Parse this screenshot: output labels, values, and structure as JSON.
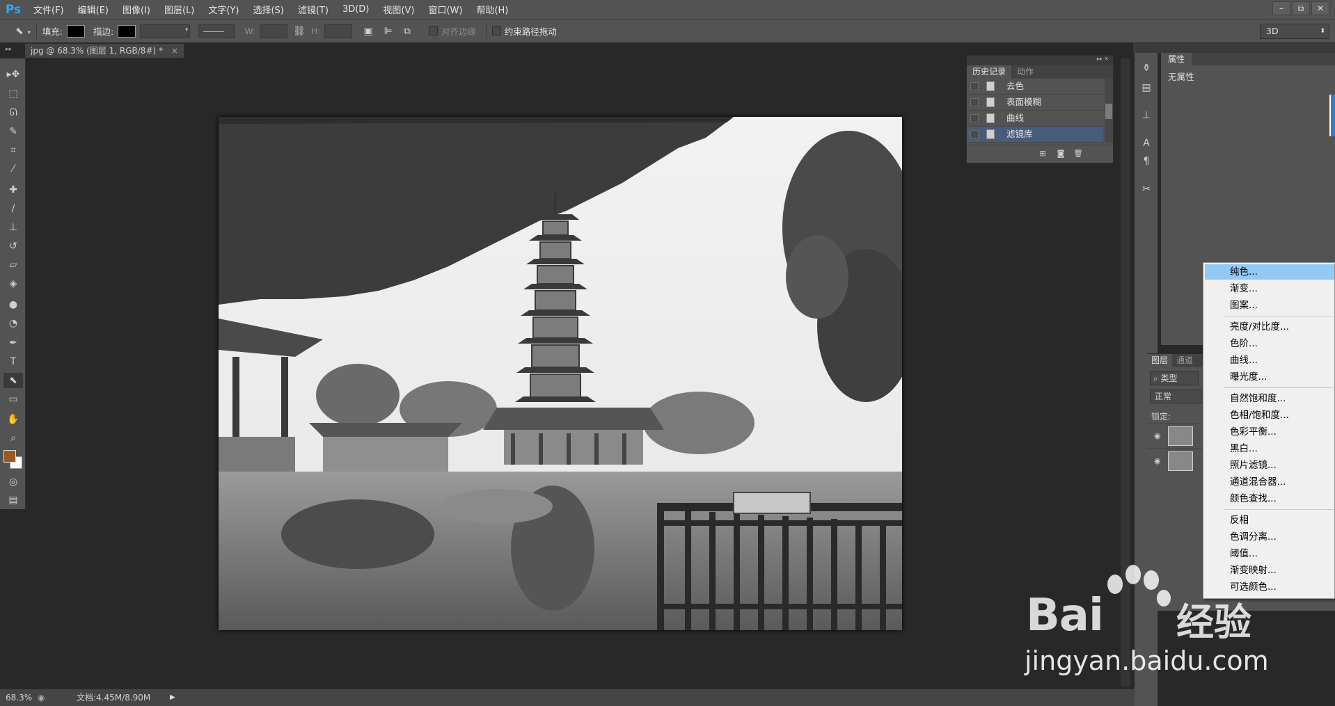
{
  "app": {
    "logo": "Ps"
  },
  "menu": [
    "文件(F)",
    "编辑(E)",
    "图像(I)",
    "图层(L)",
    "文字(Y)",
    "选择(S)",
    "滤镜(T)",
    "3D(D)",
    "视图(V)",
    "窗口(W)",
    "帮助(H)"
  ],
  "window_controls": [
    "–",
    "⧉",
    "✕"
  ],
  "options": {
    "fill_label": "填充:",
    "stroke_label": "描边:",
    "w_label": "W:",
    "h_label": "H:",
    "align_edges_label": "对齐边缘",
    "constrain_path_label": "约束路径拖动",
    "workspace": "3D"
  },
  "document": {
    "tab_title": "jpg @ 68.3% (图层 1, RGB/8#) *",
    "tab_close": "×",
    "zoom": "68.3%",
    "doc_info": "文档:4.45M/8.90M"
  },
  "tools": [
    "path-select",
    "marquee",
    "lasso",
    "quick-select",
    "crop",
    "eyedropper",
    "healing-brush",
    "brush",
    "clone-stamp",
    "history-brush",
    "eraser",
    "paint-bucket",
    "blur",
    "dodge",
    "pen",
    "type",
    "direct-select",
    "rectangle",
    "hand",
    "zoom"
  ],
  "colors": {
    "foreground": "#9a5b22",
    "background": "#ffffff",
    "accent": "#31a8ff",
    "selection": "#485b7a",
    "menu_highlight": "#91c9f7"
  },
  "history": {
    "tabs": [
      "历史记录",
      "动作"
    ],
    "items": [
      "去色",
      "表面模糊",
      "曲线",
      "滤镜库"
    ],
    "selected_index": 3
  },
  "properties": {
    "tab": "属性",
    "body": "无属性"
  },
  "layers": {
    "tabs": [
      "图层",
      "通道"
    ],
    "filter": "类型",
    "blend_mode": "正常",
    "lock_label": "锁定:"
  },
  "context_menu": {
    "groups": [
      [
        "纯色...",
        "渐变...",
        "图案..."
      ],
      [
        "亮度/对比度...",
        "色阶...",
        "曲线...",
        "曝光度..."
      ],
      [
        "自然饱和度...",
        "色相/饱和度...",
        "色彩平衡...",
        "黑白...",
        "照片滤镜...",
        "通道混合器...",
        "颜色查找..."
      ],
      [
        "反相",
        "色调分离...",
        "阈值...",
        "渐变映射...",
        "可选颜色..."
      ]
    ]
  },
  "watermark": {
    "brand": "Bai",
    "brand2": "经验",
    "url": "jingyan.baidu.com"
  }
}
